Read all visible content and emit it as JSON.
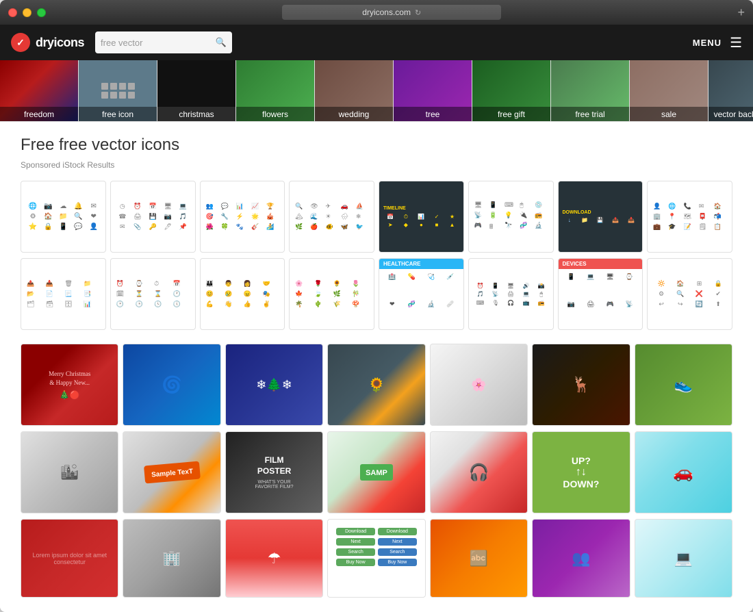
{
  "window": {
    "title": "dryicons.com",
    "url": "dryicons.com"
  },
  "header": {
    "logo": "dryicons",
    "logo_icon": "✓",
    "search_placeholder": "free vector",
    "menu_label": "MENU"
  },
  "categories": [
    {
      "id": "freedom",
      "label": "freedom",
      "class": "cat-freedom"
    },
    {
      "id": "free-icon",
      "label": "free icon",
      "class": "cat-freeicon"
    },
    {
      "id": "christmas",
      "label": "christmas",
      "class": "cat-christmas"
    },
    {
      "id": "flowers",
      "label": "flowers",
      "class": "cat-flowers"
    },
    {
      "id": "wedding",
      "label": "wedding",
      "class": "cat-wedding"
    },
    {
      "id": "tree",
      "label": "tree",
      "class": "cat-tree"
    },
    {
      "id": "free-gift",
      "label": "free gift",
      "class": "cat-freegift"
    },
    {
      "id": "free-trial",
      "label": "free trial",
      "class": "cat-freetrial"
    },
    {
      "id": "sale",
      "label": "sale",
      "class": "cat-sale"
    },
    {
      "id": "vector-background",
      "label": "vector background",
      "class": "cat-vectorbg"
    }
  ],
  "page": {
    "title": "Free free vector icons",
    "sponsored_label": "Sponsored iStock Results"
  },
  "strip_arrow": "›",
  "vector_cards_row1": [
    {
      "id": "christmas-card",
      "label": "Merry Christmas\n& Happy New...",
      "class": "vc-christmas"
    },
    {
      "id": "blue-swirl",
      "label": "",
      "class": "vc-blue-swirl"
    },
    {
      "id": "winter-scene",
      "label": "",
      "class": "vc-winter"
    },
    {
      "id": "floral-yellow",
      "label": "",
      "class": "vc-floral-yellow"
    },
    {
      "id": "grunge-floral",
      "label": "",
      "class": "vc-grunge"
    },
    {
      "id": "deer-art",
      "label": "",
      "class": "vc-deer"
    },
    {
      "id": "sneaker",
      "label": "",
      "class": "vc-sneaker"
    }
  ],
  "vector_cards_row2": [
    {
      "id": "city-scene",
      "label": "",
      "class": "vc-city"
    },
    {
      "id": "sample-text",
      "label": "Sample TexT",
      "class": "vc-sample"
    },
    {
      "id": "film-poster",
      "label": "FILM\nPOSTER",
      "class": "vc-film"
    },
    {
      "id": "music-sample",
      "label": "SAMP",
      "class": "vc-music"
    },
    {
      "id": "headphones",
      "label": "",
      "class": "vc-headphone"
    },
    {
      "id": "up-down",
      "label": "UP?\nDOWN?",
      "class": "vc-updown"
    },
    {
      "id": "car",
      "label": "",
      "class": "vc-car"
    }
  ],
  "vector_cards_row3": [
    {
      "id": "red-grunge",
      "label": "",
      "class": "vc-red-grunge"
    },
    {
      "id": "city2",
      "label": "",
      "class": "vc-city2"
    },
    {
      "id": "umbrella-girl",
      "label": "",
      "class": "vc-umbrella"
    },
    {
      "id": "buttons",
      "label": "",
      "class": "vc-buttons"
    },
    {
      "id": "orange-text",
      "label": "",
      "class": "vc-orange-text"
    },
    {
      "id": "crowd",
      "label": "",
      "class": "vc-crowd"
    },
    {
      "id": "laptop",
      "label": "",
      "class": "vc-laptop"
    }
  ]
}
